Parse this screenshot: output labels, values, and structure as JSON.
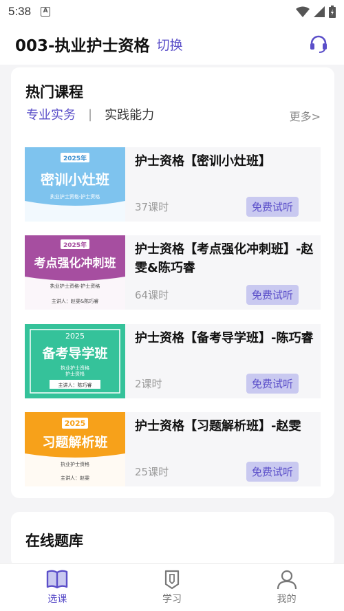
{
  "status": {
    "time": "5:38",
    "app_icon_letter": "A"
  },
  "header": {
    "title": "003-执业护士资格",
    "switch_label": "切换",
    "support_icon": "headset-icon"
  },
  "hot": {
    "title": "热门课程",
    "tab_active": "专业实务",
    "tab_separator": "|",
    "tab_other": "实践能力",
    "more": "更多>"
  },
  "trial_label": "免费试听",
  "courses": [
    {
      "title": "护士资格【密训小灶班】",
      "lessons": "37课时",
      "thumb": {
        "year": "2025年",
        "name": "密训小灶班",
        "sub": "执业护士资格-护士资格",
        "teacher": "",
        "bg": "#7ec3ee"
      }
    },
    {
      "title": "护士资格【考点强化冲刺班】-赵雯&陈巧睿",
      "lessons": "64课时",
      "thumb": {
        "year": "2025年",
        "name": "考点强化冲刺班",
        "sub": "执业护士资格-护士资格",
        "teacher": "主讲人：赵雯&陈巧睿",
        "bg": "#a64ea0"
      }
    },
    {
      "title": "护士资格【备考导学班】-陈巧睿",
      "lessons": "2课时",
      "thumb": {
        "year": "2025",
        "name": "备考导学班",
        "sub": "执业护士资格\n护士资格",
        "teacher": "主讲人：陈巧睿",
        "bg": "#35c29a"
      }
    },
    {
      "title": "护士资格【习题解析班】-赵雯",
      "lessons": "25课时",
      "thumb": {
        "year": "2025",
        "name": "习题解析班",
        "sub": "执业护士资格",
        "teacher": "主讲人：赵雯",
        "bg": "#f7a11a"
      }
    }
  ],
  "bank": {
    "title": "在线题库"
  },
  "tabbar": [
    {
      "label": "选课",
      "icon": "book-icon",
      "active": true
    },
    {
      "label": "学习",
      "icon": "bookmark-pen-icon",
      "active": false
    },
    {
      "label": "我的",
      "icon": "person-icon",
      "active": false
    }
  ],
  "colors": {
    "accent": "#5b4fc9",
    "trial_bg": "#c9c9f0"
  }
}
